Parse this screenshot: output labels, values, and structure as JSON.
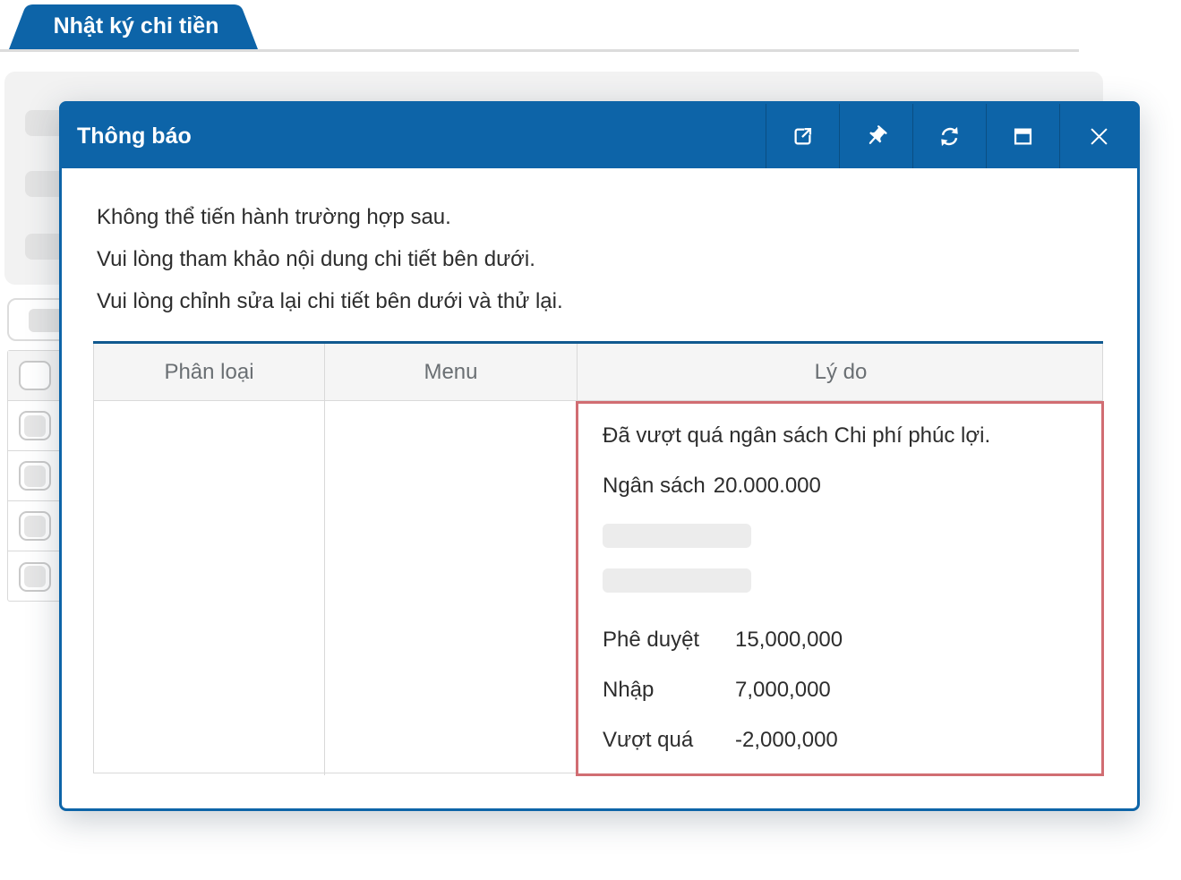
{
  "page": {
    "tab_label": "Nhật ký chi tiền"
  },
  "modal": {
    "title": "Thông báo",
    "header_actions": [
      {
        "name": "open-in-new-window"
      },
      {
        "name": "pin"
      },
      {
        "name": "refresh"
      },
      {
        "name": "maximize"
      },
      {
        "name": "close"
      }
    ],
    "messages": [
      "Không thể tiến hành trường hợp sau.",
      "Vui lòng tham khảo nội dung chi tiết bên dưới.",
      "Vui lòng chỉnh sửa lại chi tiết bên dưới và thử lại."
    ],
    "table": {
      "columns": [
        "Phân loại",
        "Menu",
        "Lý do"
      ],
      "row": {
        "phan_loai": "",
        "menu": "",
        "reason": {
          "message": "Đã vượt quá ngân sách Chi phí phúc lợi.",
          "budget_label": "Ngân sách",
          "budget_value": "20.000.000",
          "details": [
            {
              "label": "Phê duyệt",
              "value": "15,000,000"
            },
            {
              "label": "Nhập",
              "value": "7,000,000"
            },
            {
              "label": "Vượt quá",
              "value": "-2,000,000"
            }
          ]
        }
      }
    }
  },
  "colors": {
    "accent_blue": "#0d64a8",
    "table_top_border": "#11598f",
    "error_border": "#d16d72",
    "skeleton_gray": "#e3e3e3",
    "panel_gray": "#f2f2f2"
  }
}
